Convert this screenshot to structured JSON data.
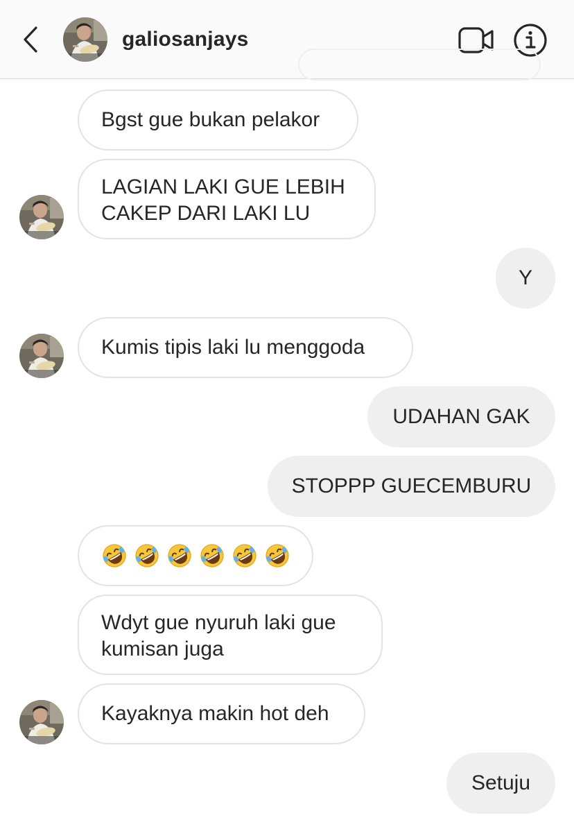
{
  "header": {
    "username": "galiosanjays",
    "back_icon": "chevron-left-icon",
    "video_icon": "video-camera-icon",
    "info_icon": "info-icon"
  },
  "messages": [
    {
      "direction": "incoming",
      "text": "Bgst gue bukan pelakor"
    },
    {
      "direction": "incoming",
      "lines": [
        "LAGIAN LAKI GUE LEBIH",
        "CAKEP DARI LAKI LU"
      ]
    },
    {
      "direction": "outgoing",
      "text": "Y"
    },
    {
      "direction": "incoming",
      "text": "Kumis tipis laki lu menggoda"
    },
    {
      "direction": "outgoing",
      "text": "UDAHAN GAK"
    },
    {
      "direction": "outgoing",
      "text": "STOPPP GUECEMBURU"
    },
    {
      "direction": "incoming",
      "emoji": "rolling-on-floor-laughing",
      "count": 6
    },
    {
      "direction": "incoming",
      "lines": [
        "Wdyt gue nyuruh laki gue",
        "kumisan juga"
      ]
    },
    {
      "direction": "incoming",
      "text": "Kayaknya makin hot deh"
    },
    {
      "direction": "outgoing",
      "text": "Setuju"
    }
  ],
  "colors": {
    "header_bg": "#fafafa",
    "text": "#262626",
    "incoming_border": "#e3e3e3",
    "outgoing_bg": "#efefef"
  }
}
